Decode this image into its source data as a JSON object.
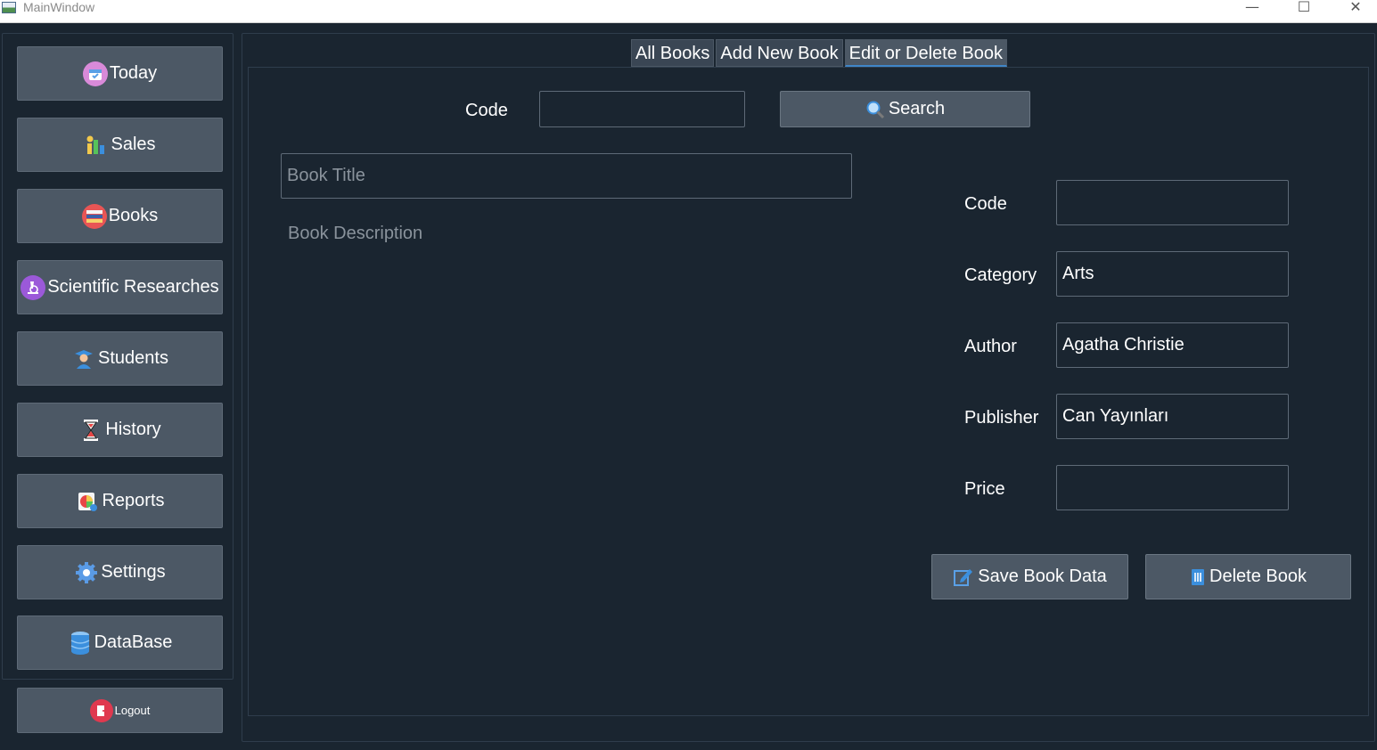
{
  "window": {
    "title": "MainWindow",
    "controls": {
      "minimize": "—",
      "maximize": "☐",
      "close": "✕"
    }
  },
  "sidebar": {
    "items": [
      {
        "label": "Today",
        "icon": "calendar-icon"
      },
      {
        "label": "Sales",
        "icon": "bar-chart-icon"
      },
      {
        "label": "Books",
        "icon": "books-icon"
      },
      {
        "label": "Scientific Researches",
        "icon": "microscope-icon"
      },
      {
        "label": "Students",
        "icon": "graduate-icon"
      },
      {
        "label": "History",
        "icon": "hourglass-icon"
      },
      {
        "label": "Reports",
        "icon": "pie-report-icon"
      },
      {
        "label": "Settings",
        "icon": "gear-icon"
      },
      {
        "label": "DataBase",
        "icon": "database-icon"
      }
    ],
    "logout": {
      "label": "Logout",
      "icon": "logout-icon"
    }
  },
  "tabs": [
    {
      "label": "All Books",
      "active": false
    },
    {
      "label": "Add New Book",
      "active": false
    },
    {
      "label": "Edit or Delete Book",
      "active": true
    }
  ],
  "search": {
    "code_label": "Code",
    "code_value": "",
    "button_label": "Search",
    "button_icon": "magnifier-icon"
  },
  "book": {
    "title_placeholder": "Book Title",
    "title_value": "",
    "description_placeholder": "Book Description",
    "description_value": ""
  },
  "details": {
    "code_label": "Code",
    "code_value": "",
    "category_label": "Category",
    "category_value": "Arts",
    "author_label": "Author",
    "author_value": "Agatha Christie",
    "publisher_label": "Publisher",
    "publisher_value": "Can Yayınları",
    "price_label": "Price",
    "price_value": ""
  },
  "actions": {
    "save_label": "Save Book Data",
    "save_icon": "edit-icon",
    "delete_label": "Delete Book",
    "delete_icon": "trash-icon"
  },
  "colors": {
    "background": "#1a2530",
    "button": "#4c5865",
    "accent": "#3f86c8"
  }
}
